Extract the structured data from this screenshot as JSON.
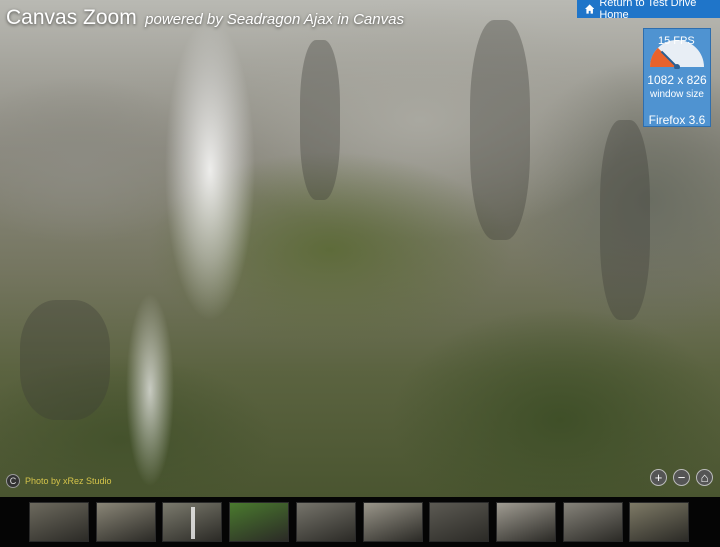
{
  "header": {
    "title": "Canvas Zoom",
    "subtitle": "powered by Seadragon Ajax in Canvas",
    "home_link_label": "Return to Test Drive Home",
    "home_icon": "home-icon"
  },
  "perf_panel": {
    "fps": "15 FPS",
    "window_size": "1082 x 826",
    "window_size_label": "window size",
    "browser": "Firefox 3.6",
    "gauge_level": 0.25
  },
  "credit": {
    "logo_glyph": "C",
    "text": "Photo by xRez Studio"
  },
  "zoom_controls": {
    "zoom_in_glyph": "+",
    "zoom_out_glyph": "−",
    "home_glyph": "⌂"
  },
  "colors": {
    "accent_blue": "#1f75c9",
    "panel_blue": "#4f93d1",
    "credit_text": "#d4c34a"
  },
  "filmstrip": {
    "thumbnails": [
      {
        "name": "thumb-cliff-1",
        "tone": "#6d6a5e"
      },
      {
        "name": "thumb-cliff-2",
        "tone": "#8a8677"
      },
      {
        "name": "thumb-waterfall",
        "tone": "#7b7a6d"
      },
      {
        "name": "thumb-meadow",
        "tone": "#4a7a2e"
      },
      {
        "name": "thumb-rock-face",
        "tone": "#76746b"
      },
      {
        "name": "thumb-granite",
        "tone": "#9a968a"
      },
      {
        "name": "thumb-dome",
        "tone": "#5c5a53"
      },
      {
        "name": "thumb-slab",
        "tone": "#a09c92"
      },
      {
        "name": "thumb-boulder",
        "tone": "#86837a"
      },
      {
        "name": "thumb-forest-slope",
        "tone": "#7e7a66"
      }
    ]
  }
}
